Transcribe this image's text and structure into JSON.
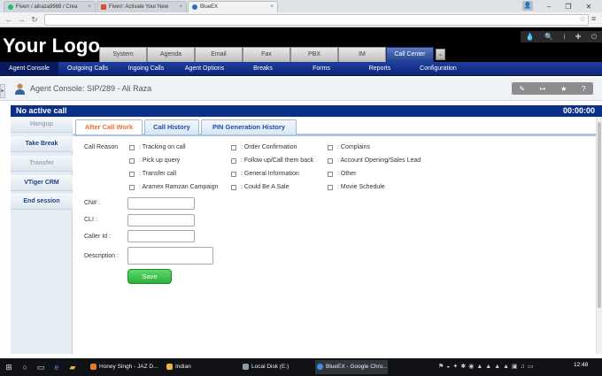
{
  "browser": {
    "tabs": [
      {
        "title": "Fiverr / aliraza9988 / Crea",
        "color": "#1dbf73"
      },
      {
        "title": "Fiverr: Activate Your New",
        "color": "#d94b3a"
      },
      {
        "title": "BlueEX",
        "color": "#2b6cc4"
      }
    ],
    "profile_label": "☰",
    "address": ""
  },
  "app": {
    "logo": "Your Logo",
    "top_tabs": [
      "System",
      "Agenda",
      "Email",
      "Fax",
      "PBX",
      "IM",
      "Call Center"
    ],
    "active_top_tab": "Call Center",
    "sub_nav": [
      "Agent Console",
      "Outgoing Calls",
      "Ingoing Calls",
      "Agent Options",
      "Breaks",
      "Forms",
      "Reports",
      "Configuration"
    ],
    "active_sub_nav": "Agent Console"
  },
  "console": {
    "title": "Agent Console: SIP/289 - Ali Raza",
    "status_left": "No active call",
    "status_timer": "00:00:00"
  },
  "left_actions": [
    {
      "label": "Hangup",
      "enabled": false
    },
    {
      "label": "Take Break",
      "enabled": true
    },
    {
      "label": "Transfer",
      "enabled": false
    },
    {
      "label": "VTiger CRM",
      "enabled": true
    },
    {
      "label": "End session",
      "enabled": true
    }
  ],
  "content_tabs": [
    "After Call Work",
    "Call History",
    "PIN Generation History"
  ],
  "active_content_tab": "After Call Work",
  "form": {
    "call_reason_label": "Call Reason",
    "reasons": [
      ": Tracking on call",
      ": Order Confirmation",
      ": Complains",
      ": Pick up query",
      ": Follow up/Call them back",
      ": Account Opening/Sales Lead",
      ": Transfer call",
      ": General Information",
      ": Other",
      ": Aramex Ramzan Campaign",
      ": Could Be A Sale",
      ": Movie Schedule"
    ],
    "cn_label": "CN# :",
    "cli_label": "CLI :",
    "caller_id_label": "Caller Id :",
    "description_label": "Description :",
    "cn_value": "",
    "cli_value": "",
    "caller_id_value": "",
    "description_value": "",
    "save_label": "Save"
  },
  "taskbar": {
    "items": [
      {
        "label": "Honey Singh - JAZ D...",
        "color": "#e3792b"
      },
      {
        "label": "Indian",
        "color": "#e9b83b"
      },
      {
        "label": "Local Disk (E:)",
        "color": "#8f9aa6"
      },
      {
        "label": "BlueEX - Google Chro...",
        "color": "#3c8ee8"
      }
    ],
    "clock": "12:48"
  }
}
